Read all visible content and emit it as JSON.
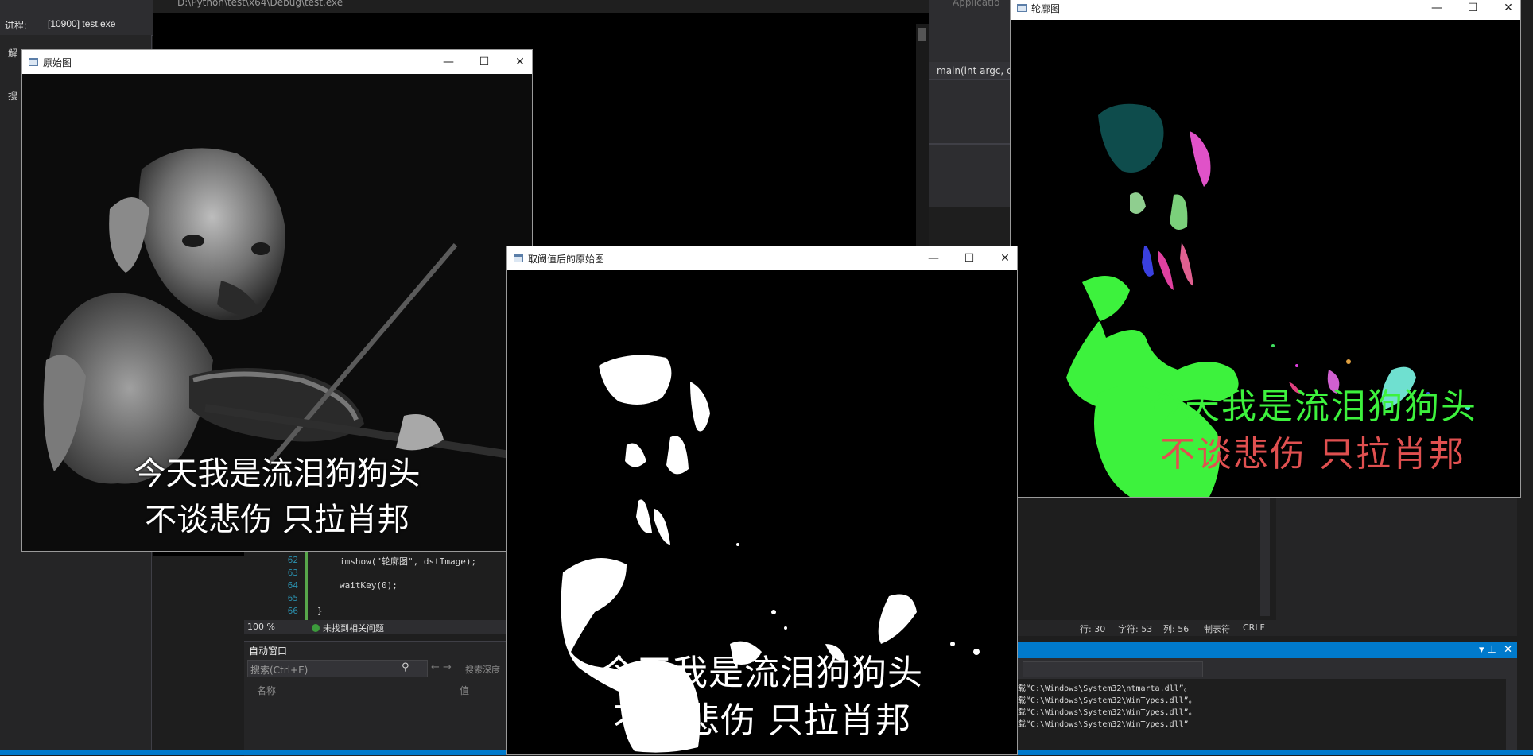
{
  "ide": {
    "process_label": "进程:",
    "process_value": "[10900] test.exe",
    "console_title": "D:\\Python\\test\\x64\\Debug\\test.exe",
    "left_tab_1": "解",
    "left_tab_2": "搜",
    "app_label": "Applicatio",
    "func_signature": "main(int argc, c",
    "code_lines": [
      {
        "num": "62",
        "text": "imshow(\"轮廓图\", dstImage);"
      },
      {
        "num": "63",
        "text": ""
      },
      {
        "num": "64",
        "text": "waitKey(0);"
      },
      {
        "num": "65",
        "text": ""
      },
      {
        "num": "66",
        "text": "}"
      }
    ],
    "zoom": "100 %",
    "issues": "未找到相关问题",
    "auto_window_title": "自动窗口",
    "search_placeholder": "搜索(Ctrl+E)",
    "search_depth": "搜索深度",
    "col_name": "名称",
    "col_value": "值",
    "status": {
      "line": "行: 30",
      "char": "字符: 53",
      "col": "列: 56",
      "tab": "制表符",
      "eol": "CRLF"
    },
    "output_lines": [
      "载“C:\\Windows\\System32\\ntmarta.dll”。",
      "载“C:\\Windows\\System32\\WinTypes.dll”。",
      "载“C:\\Windows\\System32\\WinTypes.dll”。",
      "载“C:\\Windows\\System32\\WinTypes.dll”"
    ]
  },
  "windows": {
    "original": {
      "title": "原始图",
      "caption_line1": "今天我是流泪狗狗头",
      "caption_line2": "不谈悲伤 只拉肖邦"
    },
    "threshold": {
      "title": "取阈值后的原始图",
      "caption_line1": "今天我是流泪狗狗头",
      "caption_line2": "不谈悲伤 只拉肖邦"
    },
    "contour": {
      "title": "轮廓图",
      "caption_line1": "今天我是流泪狗狗头",
      "caption_line2": "不谈悲伤 只拉肖邦"
    }
  },
  "controls": {
    "minimize": "—",
    "maximize": "☐",
    "close": "✕"
  },
  "colors": {
    "vs_bg": "#1e1e1e",
    "vs_accent": "#007acc",
    "contour_green": "#3df23d",
    "contour_teal": "#0e4c4c",
    "contour_pink": "#e052c8",
    "contour_cyan": "#6fe0d0"
  }
}
